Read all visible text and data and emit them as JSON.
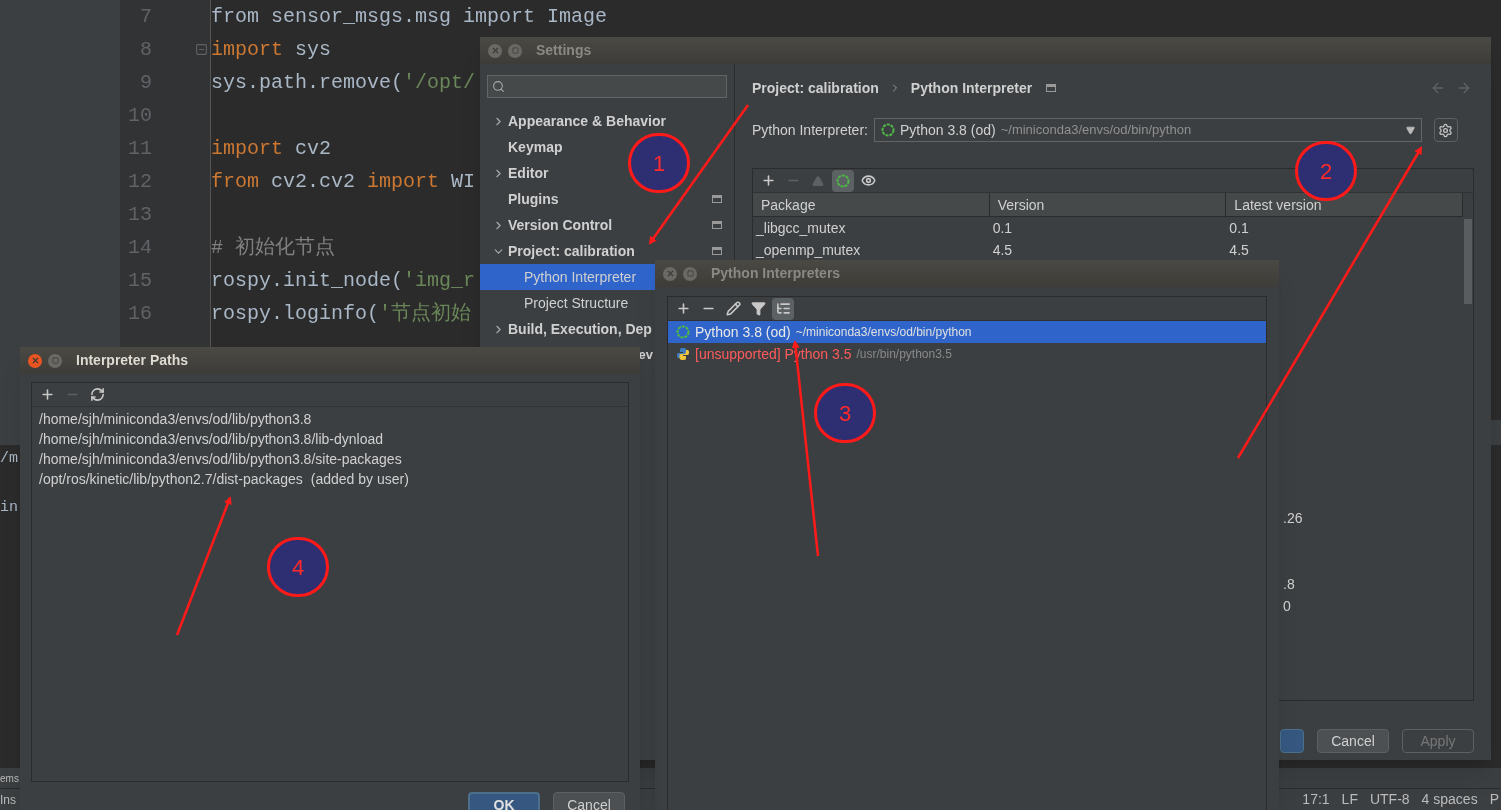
{
  "editor": {
    "lines": [
      {
        "number": "7",
        "fold": false,
        "tokens": [
          {
            "text": "from sensor_msgs.msg import Image",
            "kind": "plain"
          }
        ]
      },
      {
        "number": "8",
        "fold": true,
        "tokens": [
          {
            "text": "import",
            "kind": "keyword"
          },
          {
            "text": " sys",
            "kind": "plain"
          }
        ]
      },
      {
        "number": "9",
        "fold": false,
        "tokens": [
          {
            "text": "sys.path.remove(",
            "kind": "plain"
          },
          {
            "text": "'/opt/",
            "kind": "string"
          }
        ]
      },
      {
        "number": "10",
        "fold": false
      },
      {
        "number": "11",
        "fold": false,
        "tokens": [
          {
            "text": "import",
            "kind": "keyword"
          },
          {
            "text": " cv2",
            "kind": "plain"
          }
        ]
      },
      {
        "number": "12",
        "fold": false,
        "tokens": [
          {
            "text": "from",
            "kind": "keyword"
          },
          {
            "text": " cv2.cv2 ",
            "kind": "plain"
          },
          {
            "text": "import",
            "kind": "keyword"
          },
          {
            "text": " WI",
            "kind": "plain"
          }
        ]
      },
      {
        "number": "13",
        "fold": false
      },
      {
        "number": "14",
        "fold": false,
        "tokens": [
          {
            "text": "# 初始化节点",
            "kind": "comment"
          }
        ]
      },
      {
        "number": "15",
        "fold": false,
        "tokens": [
          {
            "text": "rospy.init_node(",
            "kind": "plain"
          },
          {
            "text": "'img_r",
            "kind": "string"
          }
        ]
      },
      {
        "number": "16",
        "fold": false,
        "tokens": [
          {
            "text": "rospy.loginfo(",
            "kind": "plain"
          },
          {
            "text": "'节点初始",
            "kind": "string"
          }
        ]
      }
    ],
    "bottom_fragments": [
      "/m",
      "in"
    ]
  },
  "status_bar": {
    "left": [
      "ems",
      "Ins"
    ],
    "right": [
      "17:1",
      "LF",
      "UTF-8",
      "4 spaces",
      "P"
    ]
  },
  "settings": {
    "title": "Settings",
    "sidebar": [
      {
        "label": "Appearance & Behavior",
        "expandable": true,
        "expanded": false,
        "selected": false,
        "project_level": false
      },
      {
        "label": "Keymap",
        "expandable": false,
        "selected": false,
        "project_level": false
      },
      {
        "label": "Editor",
        "expandable": true,
        "expanded": false,
        "selected": false,
        "project_level": false
      },
      {
        "label": "Plugins",
        "expandable": false,
        "selected": false,
        "project_level": true
      },
      {
        "label": "Version Control",
        "expandable": true,
        "expanded": false,
        "selected": false,
        "project_level": true
      },
      {
        "label": "Project: calibration",
        "expandable": true,
        "expanded": true,
        "selected": false,
        "project_level": true,
        "children": [
          {
            "label": "Python Interpreter",
            "selected": true
          },
          {
            "label": "Project Structure",
            "selected": false
          }
        ]
      },
      {
        "label": "Build, Execution, Dep",
        "expandable": true,
        "expanded": false,
        "selected": false
      }
    ],
    "hidden_item_fragment": "ev",
    "breadcrumb": [
      "Project: calibration",
      "Python Interpreter"
    ],
    "interpreter": {
      "label": "Python Interpreter:",
      "name": "Python 3.8 (od)",
      "path": "~/miniconda3/envs/od/bin/python"
    },
    "toolbar": [
      {
        "kind": "add",
        "disabled": false,
        "pressed": false
      },
      {
        "kind": "remove",
        "disabled": true,
        "pressed": false
      },
      {
        "kind": "upgrade",
        "disabled": true,
        "pressed": false
      },
      {
        "kind": "conda",
        "disabled": false,
        "pressed": true
      },
      {
        "kind": "show",
        "disabled": false,
        "pressed": false
      }
    ],
    "packages": {
      "columns": [
        "Package",
        "Version",
        "Latest version"
      ],
      "rows": [
        [
          "_libgcc_mutex",
          "0.1",
          "0.1"
        ],
        [
          "_openmp_mutex",
          "4.5",
          "4.5"
        ]
      ],
      "latest_fragments": [
        ".26",
        ".8",
        "0"
      ]
    },
    "buttons": [
      {
        "label": "Cancel",
        "disabled": false
      },
      {
        "label": "Apply",
        "disabled": true
      }
    ]
  },
  "interpreters_dialog": {
    "title": "Python Interpreters",
    "toolbar": [
      {
        "kind": "add",
        "disabled": false,
        "pressed": false
      },
      {
        "kind": "remove",
        "disabled": false,
        "pressed": false
      },
      {
        "kind": "edit",
        "disabled": false,
        "pressed": false
      },
      {
        "kind": "filter",
        "disabled": false,
        "pressed": false
      },
      {
        "kind": "tree",
        "disabled": false,
        "pressed": true
      }
    ],
    "items": [
      {
        "kind": "conda",
        "unsupported": false,
        "name": "Python 3.8 (od)",
        "path": "~/miniconda3/envs/od/bin/python",
        "selected": true
      },
      {
        "kind": "system",
        "unsupported": true,
        "prefix": "[unsupported]",
        "name": "Python 3.5",
        "path": "/usr/bin/python3.5",
        "selected": false
      }
    ]
  },
  "paths_dialog": {
    "title": "Interpreter Paths",
    "toolbar": [
      {
        "kind": "add",
        "disabled": false,
        "pressed": false
      },
      {
        "kind": "remove",
        "disabled": true,
        "pressed": false
      },
      {
        "kind": "reload",
        "disabled": false,
        "pressed": false
      }
    ],
    "paths": [
      {
        "path": "/home/sjh/miniconda3/envs/od/lib/python3.8"
      },
      {
        "path": "/home/sjh/miniconda3/envs/od/lib/python3.8/lib-dynload"
      },
      {
        "path": "/home/sjh/miniconda3/envs/od/lib/python3.8/site-packages"
      },
      {
        "path": "/opt/ros/kinetic/lib/python2.7/dist-packages",
        "note": "(added by user)"
      }
    ],
    "buttons": [
      "OK",
      "Cancel"
    ]
  },
  "annotations": [
    "1",
    "2",
    "3",
    "4"
  ]
}
